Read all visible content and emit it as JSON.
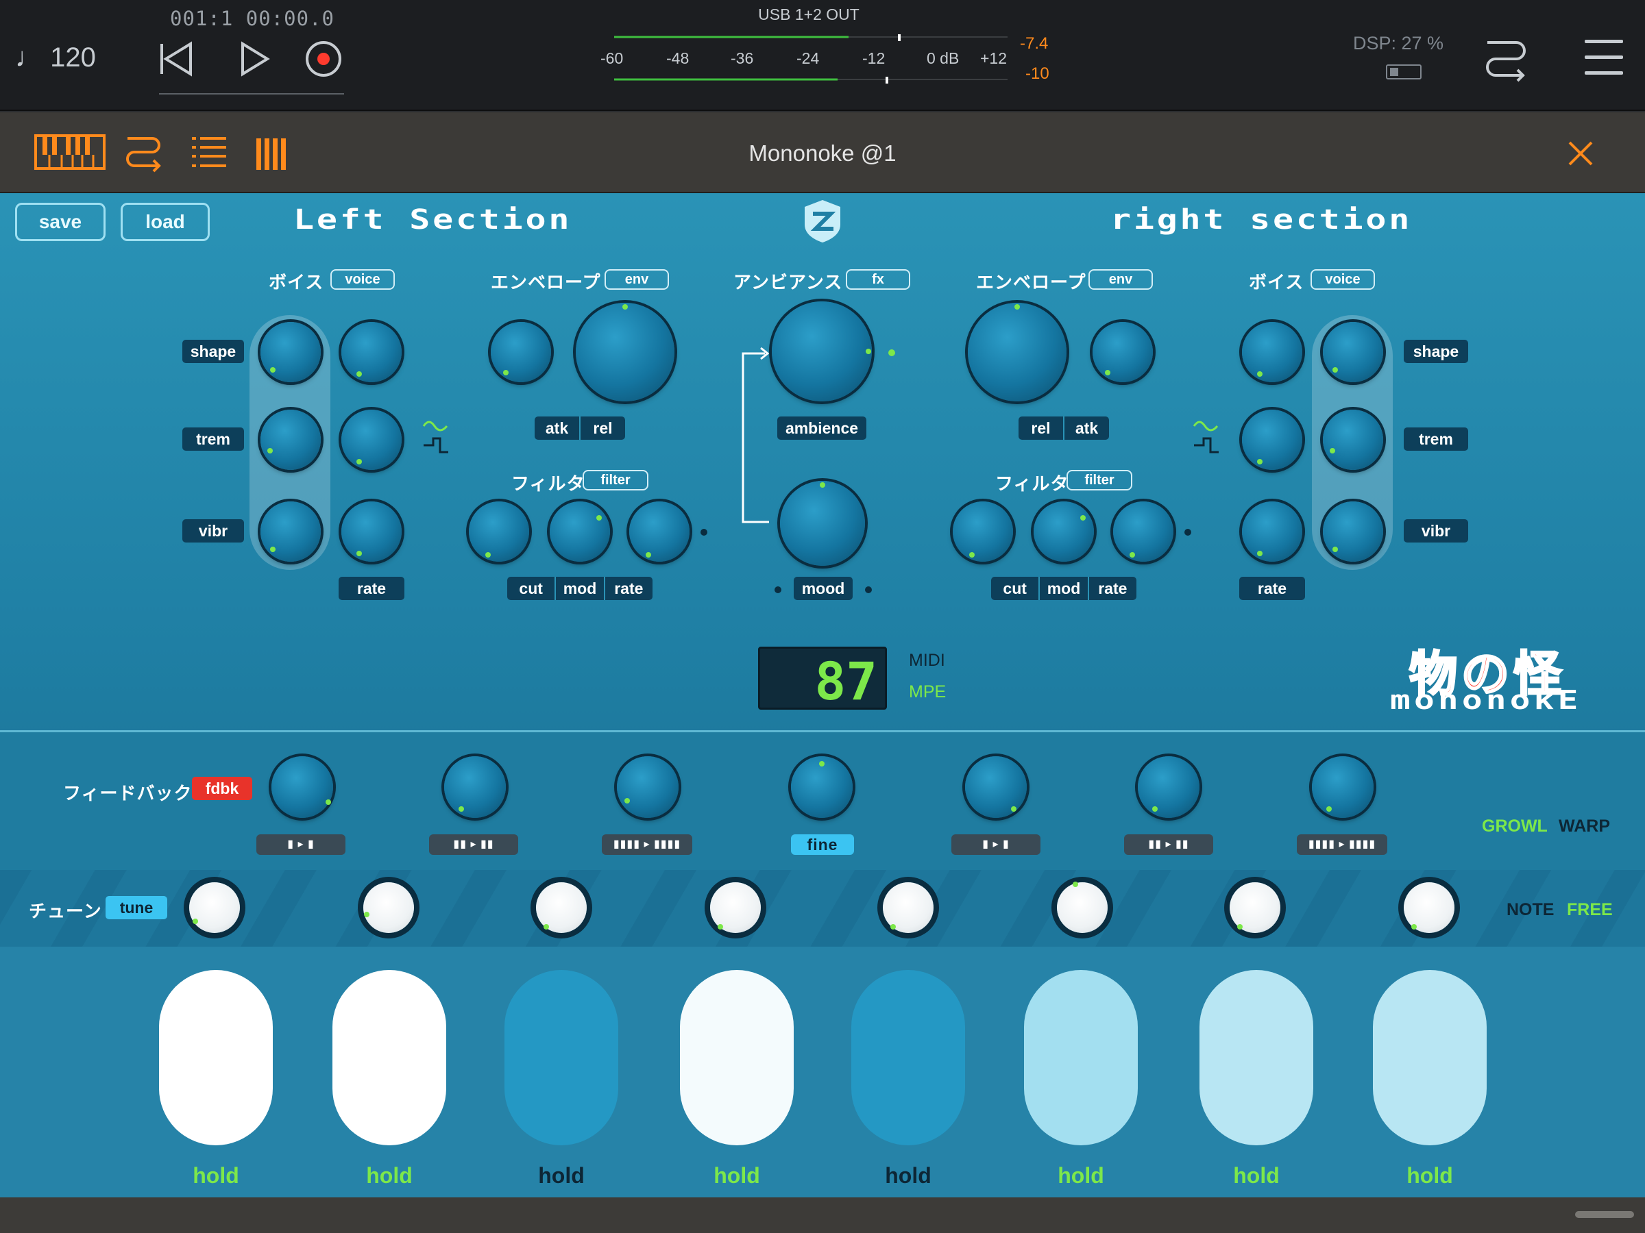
{
  "transport": {
    "tempo": "♩ 120",
    "position": "001:1   00:00.0",
    "meter_title": "USB 1+2 OUT",
    "meter_ticks": [
      "-60",
      "-48",
      "-36",
      "-24",
      "-12",
      "0 dB",
      "+12"
    ],
    "peak_left": "-7.4",
    "peak_right": "-10",
    "dsp": "DSP: 27 %"
  },
  "header": {
    "title": "Mononoke @1",
    "icons": [
      "keyboard-icon",
      "route-icon",
      "list-icon",
      "bars-icon",
      "close-icon"
    ]
  },
  "synth": {
    "save_label": "save",
    "load_label": "load",
    "left_section": "Left Section",
    "right_section": "right section",
    "left_voice": {
      "jp": "ボイス",
      "pill": "voice",
      "rows": [
        "shape",
        "trem",
        "vibr"
      ],
      "rate": "rate"
    },
    "left_env": {
      "jp": "エンベロープ",
      "pill": "env",
      "labels": [
        "atk",
        "rel"
      ]
    },
    "left_filter": {
      "jp": "フィルタ",
      "pill": "filter",
      "labels": [
        "cut",
        "mod",
        "rate"
      ]
    },
    "fx": {
      "jp": "アンビアンス",
      "pill": "fx",
      "ambience": "ambience",
      "mood": "mood"
    },
    "right_env": {
      "jp": "エンベロープ",
      "pill": "env",
      "labels": [
        "rel",
        "atk"
      ]
    },
    "right_filter": {
      "jp": "フィルタ",
      "pill": "filter",
      "labels": [
        "cut",
        "mod",
        "rate"
      ]
    },
    "right_voice": {
      "jp": "ボイス",
      "pill": "voice",
      "rows": [
        "shape",
        "trem",
        "vibr"
      ],
      "rate": "rate"
    },
    "display": {
      "value": "87",
      "midi": "MIDI",
      "mpe": "MPE"
    },
    "brand_jp": "物の怪",
    "brand_en": "mononokE"
  },
  "feedback": {
    "jp": "フィードバック",
    "tag": "fdbk",
    "buttons": [
      "▮ ▸ ▮",
      "▮▮ ▸ ▮▮",
      "▮▮▮▮ ▸ ▮▮▮▮",
      "fine",
      "▮ ▸ ▮",
      "▮▮ ▸ ▮▮",
      "▮▮▮▮ ▸ ▮▮▮▮"
    ],
    "growl": "GROWL",
    "warp": "WARP"
  },
  "tune": {
    "jp": "チューン",
    "tag": "tune",
    "note": "NOTE",
    "free": "FREE"
  },
  "pads": [
    {
      "label": "hold",
      "label_color": "#7de84a",
      "fill": "#ffffff"
    },
    {
      "label": "hold",
      "label_color": "#7de84a",
      "fill": "#ffffff"
    },
    {
      "label": "hold",
      "label_color": "#0d2635",
      "fill": "#2498c4"
    },
    {
      "label": "hold",
      "label_color": "#7de84a",
      "fill": "#f4fbfd"
    },
    {
      "label": "hold",
      "label_color": "#0d2635",
      "fill": "#2498c4"
    },
    {
      "label": "hold",
      "label_color": "#7de84a",
      "fill": "#a3dff0"
    },
    {
      "label": "hold",
      "label_color": "#7de84a",
      "fill": "#b8e6f3"
    },
    {
      "label": "hold",
      "label_color": "#7de84a",
      "fill": "#b8e6f3"
    }
  ],
  "colors": {
    "accent_green": "#7de84a",
    "accent_orange": "#ff8a1c",
    "brand_red": "#ff3b2e",
    "panel_blue": "#2a93b6"
  }
}
